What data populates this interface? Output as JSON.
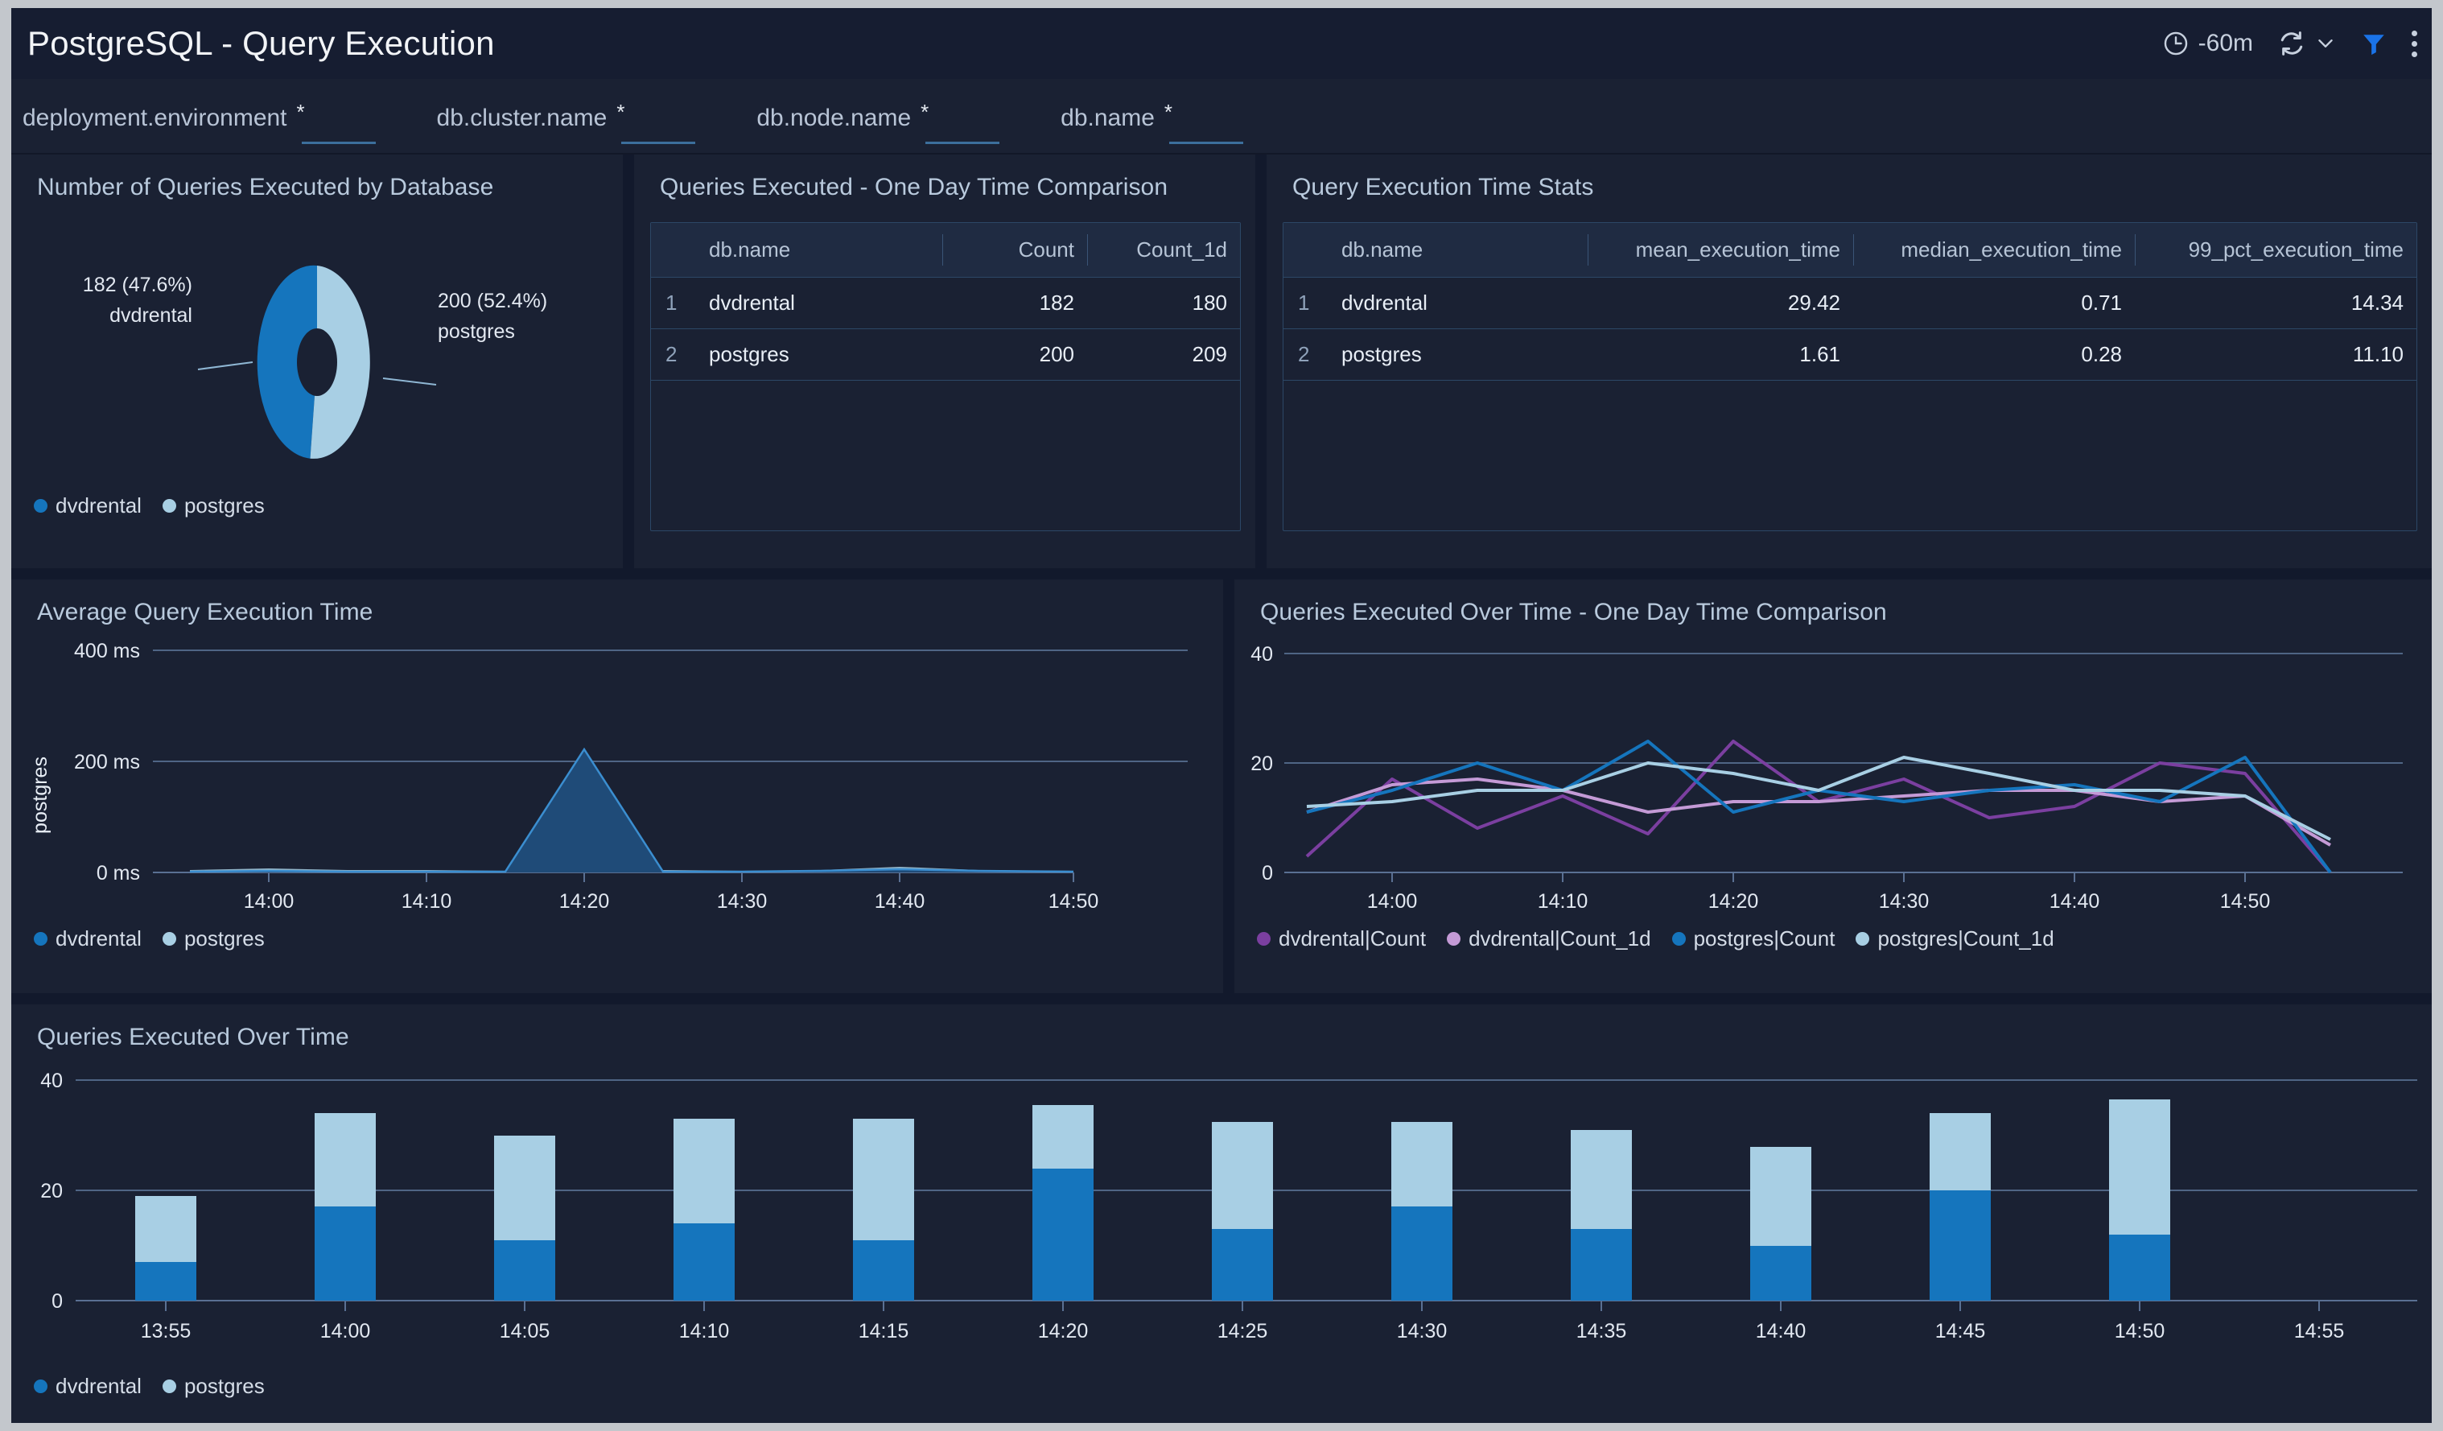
{
  "header": {
    "title": "PostgreSQL - Query Execution",
    "time_range": "-60m",
    "icons": {
      "clock": "clock-icon",
      "refresh": "refresh-icon",
      "chevron": "chevron-down-icon",
      "filter": "filter-icon",
      "kebab": "more-options-icon"
    }
  },
  "variables": [
    {
      "label": "deployment.environment",
      "value": "*"
    },
    {
      "label": "db.cluster.name",
      "value": "*"
    },
    {
      "label": "db.node.name",
      "value": "*"
    },
    {
      "label": "db.name",
      "value": "*"
    }
  ],
  "colors": {
    "dvdrental": "#1575bd",
    "postgres": "#a8cfe4",
    "dvdrental_count": "#7b3fa0",
    "dvdrental_count_1d": "#c49ad6",
    "postgres_count": "#1575bd",
    "postgres_count_1d": "#a8cfe4",
    "panel_bg": "#1a2133",
    "page_bg": "#12192c",
    "accent": "#1a73e8"
  },
  "panels": {
    "donut": {
      "title": "Number of Queries Executed by Database",
      "labels": {
        "left": {
          "value": "182 (47.6%)",
          "name": "dvdrental"
        },
        "right": {
          "value": "200 (52.4%)",
          "name": "postgres"
        }
      },
      "legend": [
        "dvdrental",
        "postgres"
      ]
    },
    "table_counts": {
      "title": "Queries Executed - One Day Time Comparison",
      "columns": [
        "",
        "db.name",
        "Count",
        "Count_1d"
      ],
      "rows": [
        {
          "idx": "1",
          "name": "dvdrental",
          "count": "182",
          "count_1d": "180"
        },
        {
          "idx": "2",
          "name": "postgres",
          "count": "200",
          "count_1d": "209"
        }
      ]
    },
    "table_stats": {
      "title": "Query Execution Time Stats",
      "columns": [
        "",
        "db.name",
        "mean_execution_time",
        "median_execution_time",
        "99_pct_execution_time"
      ],
      "rows": [
        {
          "idx": "1",
          "name": "dvdrental",
          "mean": "29.42",
          "median": "0.71",
          "p99": "14.34"
        },
        {
          "idx": "2",
          "name": "postgres",
          "mean": "1.61",
          "median": "0.28",
          "p99": "11.10"
        }
      ]
    },
    "avg_exec": {
      "title": "Average Query Execution Time",
      "legend": [
        "dvdrental",
        "postgres"
      ]
    },
    "over_time_cmp": {
      "title": "Queries Executed Over Time - One Day Time Comparison",
      "legend": [
        "dvdrental|Count",
        "dvdrental|Count_1d",
        "postgres|Count",
        "postgres|Count_1d"
      ]
    },
    "over_time": {
      "title": "Queries Executed Over Time",
      "legend": [
        "dvdrental",
        "postgres"
      ]
    }
  },
  "chart_data": [
    {
      "id": "donut",
      "type": "pie",
      "title": "Number of Queries Executed by Database",
      "labels": [
        "dvdrental",
        "postgres"
      ],
      "values": [
        182,
        200
      ],
      "percents": [
        47.6,
        52.4
      ],
      "colors": [
        "#1575bd",
        "#a8cfe4"
      ],
      "donut": true,
      "legend_position": "bottom-left"
    },
    {
      "id": "avg-query-execution-time",
      "type": "area",
      "title": "Average Query Execution Time",
      "xlabel": "",
      "ylabel": "postgres",
      "ytick_labels": [
        "0 ms",
        "200 ms",
        "400 ms"
      ],
      "ylim": [
        0,
        400
      ],
      "x": [
        "13:55",
        "14:00",
        "14:05",
        "14:10",
        "14:15",
        "14:20",
        "14:25",
        "14:30",
        "14:35",
        "14:40",
        "14:45",
        "14:50"
      ],
      "xtick_labels": [
        "14:00",
        "14:10",
        "14:20",
        "14:30",
        "14:40",
        "14:50"
      ],
      "grid": true,
      "series": [
        {
          "name": "dvdrental",
          "color": "#1575bd",
          "values": [
            2,
            3,
            2,
            2,
            2,
            220,
            2,
            2,
            3,
            6,
            3,
            2
          ]
        },
        {
          "name": "postgres",
          "color": "#a8cfe4",
          "values": [
            4,
            5,
            4,
            4,
            3,
            4,
            4,
            3,
            4,
            7,
            4,
            3
          ]
        }
      ],
      "legend_position": "bottom-left"
    },
    {
      "id": "queries-executed-over-time-one-day-comparison",
      "type": "line",
      "title": "Queries Executed Over Time - One Day Time Comparison",
      "xlabel": "",
      "ylabel": "",
      "ylim": [
        0,
        40
      ],
      "ytick_labels": [
        "0",
        "20",
        "40"
      ],
      "x": [
        "13:55",
        "14:00",
        "14:05",
        "14:10",
        "14:15",
        "14:20",
        "14:25",
        "14:30",
        "14:35",
        "14:40",
        "14:45",
        "14:50",
        "14:55"
      ],
      "xtick_labels": [
        "14:00",
        "14:10",
        "14:20",
        "14:30",
        "14:40",
        "14:50"
      ],
      "grid": true,
      "series": [
        {
          "name": "dvdrental|Count",
          "color": "#7b3fa0",
          "values": [
            3,
            17,
            8,
            14,
            7,
            24,
            13,
            17,
            10,
            12,
            20,
            18,
            0
          ]
        },
        {
          "name": "dvdrental|Count_1d",
          "color": "#c49ad6",
          "values": [
            11,
            16,
            17,
            15,
            11,
            13,
            13,
            14,
            15,
            15,
            13,
            14,
            5
          ]
        },
        {
          "name": "postgres|Count",
          "color": "#1575bd",
          "values": [
            11,
            15,
            20,
            15,
            24,
            11,
            15,
            13,
            15,
            16,
            13,
            21,
            0
          ]
        },
        {
          "name": "postgres|Count_1d",
          "color": "#a8cfe4",
          "values": [
            12,
            13,
            15,
            15,
            20,
            18,
            15,
            21,
            18,
            15,
            15,
            14,
            6
          ]
        }
      ],
      "legend_position": "bottom-left"
    },
    {
      "id": "queries-executed-over-time",
      "type": "bar",
      "title": "Queries Executed Over Time",
      "stacked": true,
      "xlabel": "",
      "ylabel": "",
      "ylim": [
        0,
        40
      ],
      "ytick_labels": [
        "0",
        "20",
        "40"
      ],
      "categories": [
        "13:55",
        "14:00",
        "14:05",
        "14:10",
        "14:15",
        "14:20",
        "14:25",
        "14:30",
        "14:35",
        "14:40",
        "14:45",
        "14:50",
        "14:55"
      ],
      "grid": true,
      "series": [
        {
          "name": "dvdrental",
          "color": "#1575bd",
          "values": [
            7,
            17,
            11,
            14,
            11,
            24,
            13,
            17,
            13,
            10,
            20,
            12,
            0
          ]
        },
        {
          "name": "postgres",
          "color": "#a8cfe4",
          "values": [
            12,
            17,
            19,
            19,
            19,
            11,
            18,
            16,
            17,
            16,
            14,
            22,
            0
          ]
        }
      ],
      "legend_position": "bottom-left"
    }
  ]
}
